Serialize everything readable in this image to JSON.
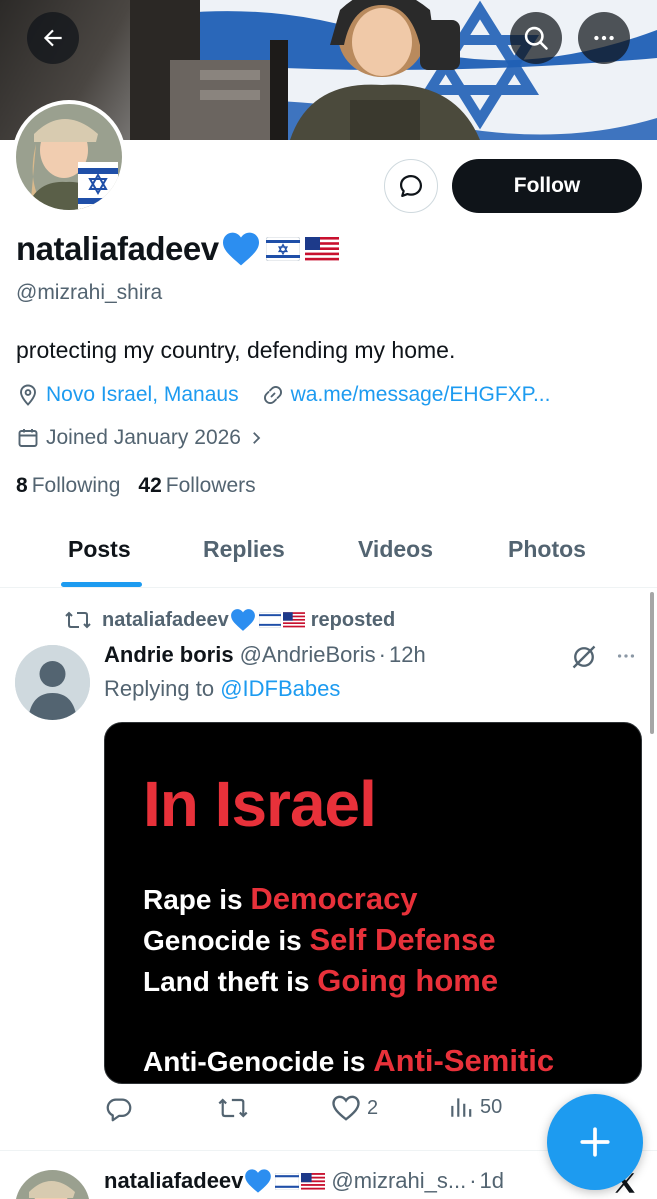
{
  "profile": {
    "display_name": "nataliafadeev",
    "handle": "@mizrahi_shira",
    "bio": "protecting my country, defending my home.",
    "location": "Novo Israel, Manaus",
    "website": "wa.me/message/EHGFXP...",
    "joined": "Joined January 2026",
    "following_count": "8",
    "following_label": "Following",
    "followers_count": "42",
    "followers_label": "Followers",
    "follow_label": "Follow"
  },
  "tabs": [
    {
      "label": "Posts"
    },
    {
      "label": "Replies"
    },
    {
      "label": "Videos"
    },
    {
      "label": "Photos"
    }
  ],
  "post": {
    "repost_by": "nataliafadeev",
    "repost_label": "reposted",
    "author_name": "Andrie boris",
    "author_handle": "@AndrieBoris",
    "separator": "·",
    "time": "12h",
    "replying_label": "Replying to",
    "replying_handle": "@IDFBabes",
    "media": {
      "headline": "In Israel",
      "lines": [
        {
          "white": "Rape is",
          "red": "Democracy"
        },
        {
          "white": "Genocide is",
          "red": "Self Defense"
        },
        {
          "white": "Land theft is",
          "red": "Going home"
        },
        {
          "white": "Anti-Genocide is",
          "red": "Anti-Semitic"
        }
      ]
    },
    "likes": "2",
    "views": "50"
  },
  "post2": {
    "author_name": "nataliafadeev",
    "author_handle": "@mizrahi_s...",
    "separator": "·",
    "time": "1d"
  },
  "colors": {
    "accent": "#1d9bf0",
    "text": "#0f1419",
    "muted": "#536471",
    "follow_bg": "#0f1419"
  },
  "icons": [
    "back-arrow-icon",
    "search-icon",
    "more-icon",
    "message-icon",
    "location-icon",
    "link-icon",
    "calendar-icon",
    "chevron-right-icon",
    "repost-icon",
    "grok-icon",
    "reply-icon",
    "like-icon",
    "views-icon",
    "compose-plus-icon",
    "x-logo-icon"
  ]
}
